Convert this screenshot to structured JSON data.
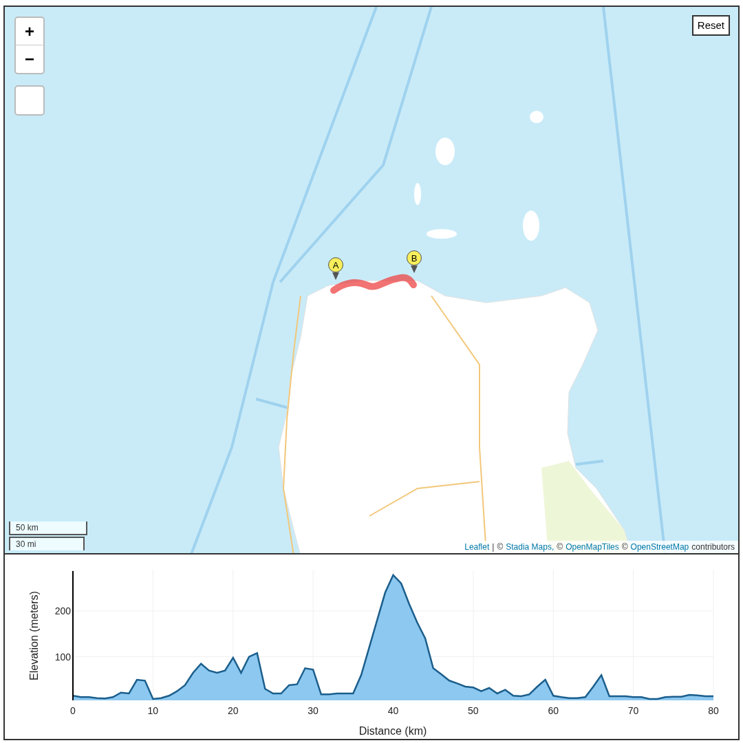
{
  "map": {
    "zoom_in": "+",
    "zoom_out": "−",
    "reset": "Reset",
    "markers": [
      {
        "label": "A"
      },
      {
        "label": "B"
      }
    ],
    "scale": [
      "50 km",
      "30 mi"
    ],
    "attribution": [
      {
        "text": "Leaflet",
        "link": true
      },
      {
        "text": "|",
        "link": false
      },
      {
        "text": "©",
        "link": false
      },
      {
        "text": "Stadia Maps,",
        "link": true
      },
      {
        "text": "©",
        "link": false
      },
      {
        "text": "OpenMapTiles",
        "link": true
      },
      {
        "text": "©",
        "link": false
      },
      {
        "text": "OpenStreetMap",
        "link": true
      },
      {
        "text": "contributors",
        "link": false
      }
    ]
  },
  "elevation": {
    "chart_data": {
      "type": "area",
      "xlabel": "Distance (km)",
      "ylabel": "Elevation (meters)",
      "x": [
        0,
        1,
        2,
        3,
        4,
        5,
        6,
        7,
        8,
        9,
        10,
        11,
        12,
        13,
        14,
        15,
        16,
        17,
        18,
        19,
        20,
        21,
        22,
        23,
        24,
        25,
        26,
        27,
        28,
        29,
        30,
        31,
        32,
        33,
        34,
        35,
        36,
        37,
        38,
        39,
        40,
        41,
        42,
        43,
        44,
        45,
        46,
        47,
        48,
        49,
        50,
        51,
        52,
        53,
        54,
        55,
        56,
        57,
        58,
        59,
        60,
        61,
        62,
        63,
        64,
        65,
        66,
        67,
        68,
        69,
        70,
        71,
        72,
        73,
        74,
        75,
        76,
        77,
        78,
        79,
        80
      ],
      "series": [
        {
          "color": "#1b5e8c",
          "values": [
            15,
            12,
            12,
            10,
            9,
            12,
            22,
            20,
            50,
            48,
            8,
            10,
            15,
            25,
            38,
            65,
            85,
            70,
            65,
            70,
            98,
            65,
            100,
            108,
            30,
            20,
            20,
            38,
            40,
            75,
            72,
            18,
            18,
            20,
            20,
            20,
            60,
            120,
            180,
            240,
            278,
            260,
            215,
            175,
            140,
            75,
            62,
            48,
            42,
            35,
            33,
            25,
            32,
            20,
            28,
            15,
            14,
            18,
            35,
            50,
            15,
            12,
            10,
            10,
            12,
            35,
            60,
            14,
            14,
            14,
            12,
            12,
            8,
            8,
            12,
            13,
            13,
            17,
            16,
            14,
            14
          ]
        }
      ],
      "xlim": [
        0,
        80
      ],
      "ylim": [
        5,
        290
      ],
      "grid": true,
      "xticks": [
        0,
        10,
        20,
        30,
        40,
        50,
        60,
        70,
        80
      ],
      "yticks": [
        100,
        200
      ]
    }
  }
}
